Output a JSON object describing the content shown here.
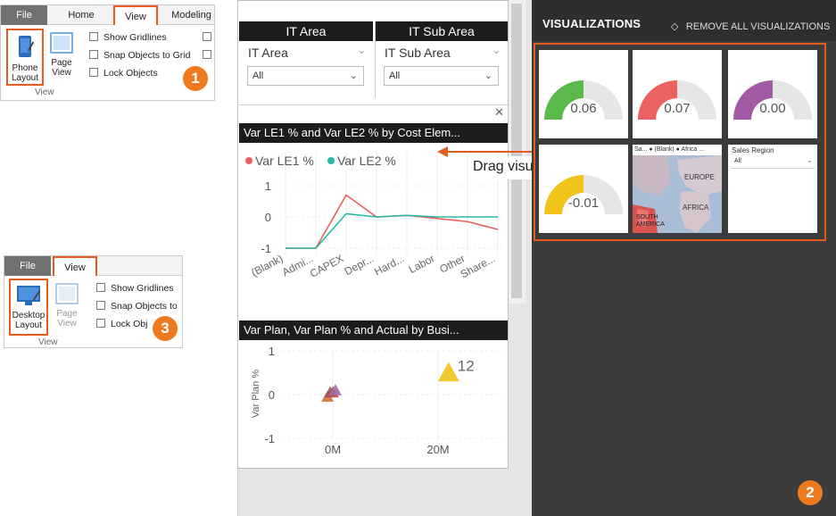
{
  "ribbon_top": {
    "tabs": [
      "File",
      "Home",
      "View",
      "Modeling"
    ],
    "phone_layout_label": "Phone\nLayout",
    "page_view_label": "Page\nView",
    "checks": [
      "Show Gridlines",
      "Snap Objects to Grid",
      "Lock Objects"
    ],
    "group": "View",
    "badge": "1"
  },
  "ribbon_bottom": {
    "tabs": [
      "File",
      "View"
    ],
    "desktop_layout_label": "Desktop\nLayout",
    "page_view_label": "Page\nView",
    "checks": [
      "Show Gridlines",
      "Snap Objects to",
      "Lock Obj"
    ],
    "group": "View",
    "badge": "3"
  },
  "phone_canvas": {
    "slicers": [
      {
        "header": "IT Area",
        "dropdown": "IT Area",
        "value": "All"
      },
      {
        "header": "IT Sub Area",
        "dropdown": "IT Sub Area",
        "value": "All"
      }
    ],
    "chart1": {
      "title": "Var LE1 % and Var LE2 % by Cost Elem...",
      "close": "✕"
    },
    "chart2": {
      "title": "Var Plan, Var Plan % and Actual by Busi..."
    },
    "drag_label": "Drag visuals"
  },
  "chart_data": [
    {
      "type": "line",
      "title": "Var LE1 % and Var LE2 % by Cost Elem...",
      "categories": [
        "(Blank)",
        "Admi...",
        "CAPEX",
        "Depr...",
        "Hard...",
        "Labor",
        "Other",
        "Share..."
      ],
      "series": [
        {
          "name": "Var LE1 %",
          "color": "#e8605c",
          "values": [
            -1,
            -1,
            0.7,
            0,
            0.05,
            -0.05,
            -0.15,
            -0.4
          ]
        },
        {
          "name": "Var LE2 %",
          "color": "#26b8a6",
          "values": [
            -1,
            -1,
            0.1,
            0,
            0.05,
            0,
            0,
            0
          ]
        }
      ],
      "yticks": [
        "1",
        "0",
        "-1"
      ],
      "ylim": [
        -1,
        1
      ],
      "legend": "top-left"
    },
    {
      "type": "scatter",
      "title": "Var Plan, Var Plan % and Actual by Busi...",
      "ylabel": "Var Plan %",
      "yticks": [
        "1",
        "0",
        "-1"
      ],
      "xticks": [
        "0M",
        "20M"
      ],
      "points": [
        {
          "x": -1000000,
          "y": -0.05,
          "color": "#d9713a"
        },
        {
          "x": -500000,
          "y": 0.05,
          "color": "#8a5b6e"
        },
        {
          "x": 0,
          "y": 0.05,
          "color": "#c4534e"
        },
        {
          "x": 500000,
          "y": 0.1,
          "color": "#a468a8"
        },
        {
          "x": 22000000,
          "y": 0.5,
          "color": "#f0c419",
          "label": "12"
        }
      ]
    }
  ],
  "visualizations": {
    "title": "VISUALIZATIONS",
    "remove_all": "REMOVE ALL VISUALIZATIONS",
    "gauges": [
      {
        "value": "0.06",
        "color": "#5bb84a",
        "fill": 0.5
      },
      {
        "value": "0.07",
        "color": "#ec6162",
        "fill": 0.5
      },
      {
        "value": "0.00",
        "color": "#a15aa3",
        "fill": 0.5
      },
      {
        "value": "-0.01",
        "color": "#f0c419",
        "fill": 0.5
      }
    ],
    "map": {
      "legend": "Sa... ● (Blank) ● Africa ...",
      "labels": [
        "EUROPE",
        "AFRICA",
        "SOUTH AMERICA"
      ]
    },
    "slicer": {
      "header": "Sales Region",
      "value": "All"
    },
    "badge": "2"
  }
}
